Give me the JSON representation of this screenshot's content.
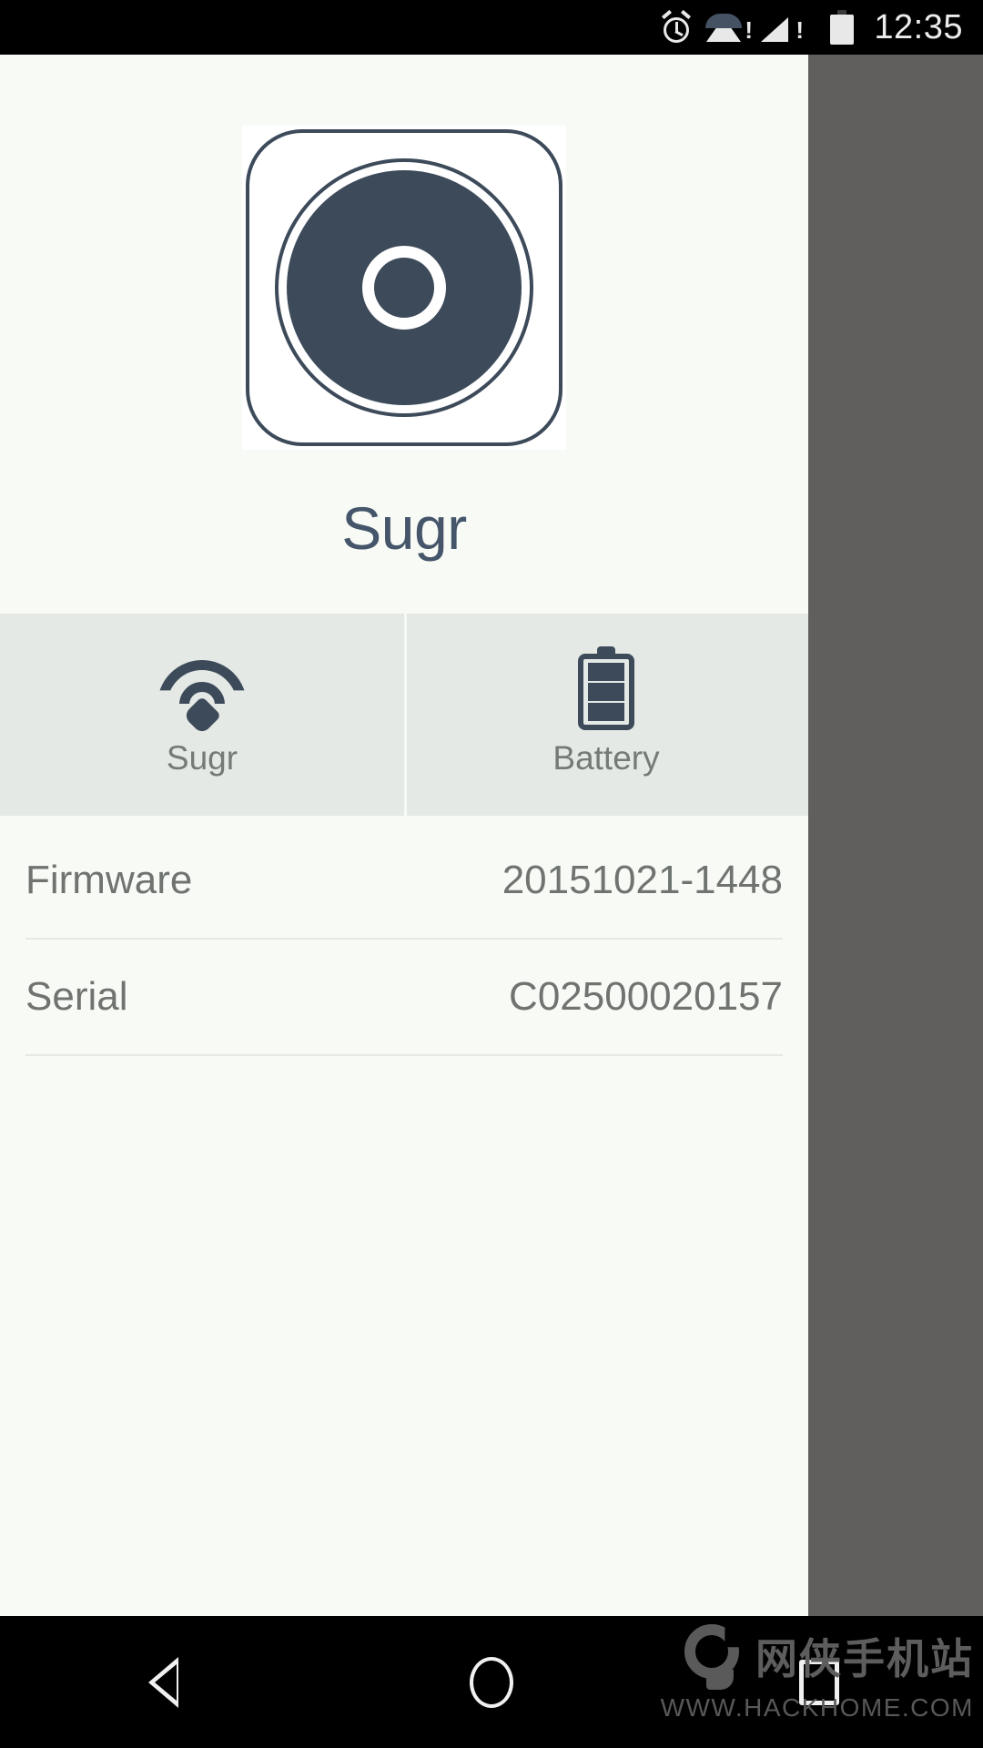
{
  "status_bar": {
    "time": "12:35",
    "icons": [
      {
        "name": "alarm-icon",
        "label": "alarm"
      },
      {
        "name": "wifi-warning-icon",
        "label": "wifi-no-internet"
      },
      {
        "name": "cellular-warning-icon",
        "label": "signal-no-service"
      },
      {
        "name": "battery-full-icon",
        "label": "battery-full"
      }
    ],
    "background": "#000000"
  },
  "app": {
    "background": "#f7faf5",
    "hero": {
      "device_icon_name": "sugr-device-icon",
      "device_name": "Sugr",
      "accent_color": "#3d4a5a",
      "title_color": "#45556a"
    },
    "tabs": [
      {
        "label": "Sugr",
        "icon": "wifi-icon",
        "name": "tab-sugr"
      },
      {
        "label": "Battery",
        "icon": "battery-icon",
        "name": "tab-battery"
      }
    ],
    "tab_bar": {
      "background": "#e4e9e5",
      "label_color": "#747a76"
    },
    "info_rows": [
      {
        "key": "Firmware",
        "value": "20151021-1448"
      },
      {
        "key": "Serial",
        "value": "C02500020157"
      }
    ],
    "info_text_color": "#6f7471"
  },
  "nav_bar": {
    "background": "#000000",
    "buttons": [
      {
        "name": "nav-back-button",
        "icon": "triangle-left-icon"
      },
      {
        "name": "nav-home-button",
        "icon": "circle-icon"
      },
      {
        "name": "nav-recents-button",
        "icon": "square-icon"
      }
    ]
  },
  "watermark": {
    "site_name": "网侠手机站",
    "url": "WWW.HACKHOME.COM",
    "logo_name": "hackhome-logo-icon"
  },
  "side_panel": {
    "background": "#605f5d"
  }
}
